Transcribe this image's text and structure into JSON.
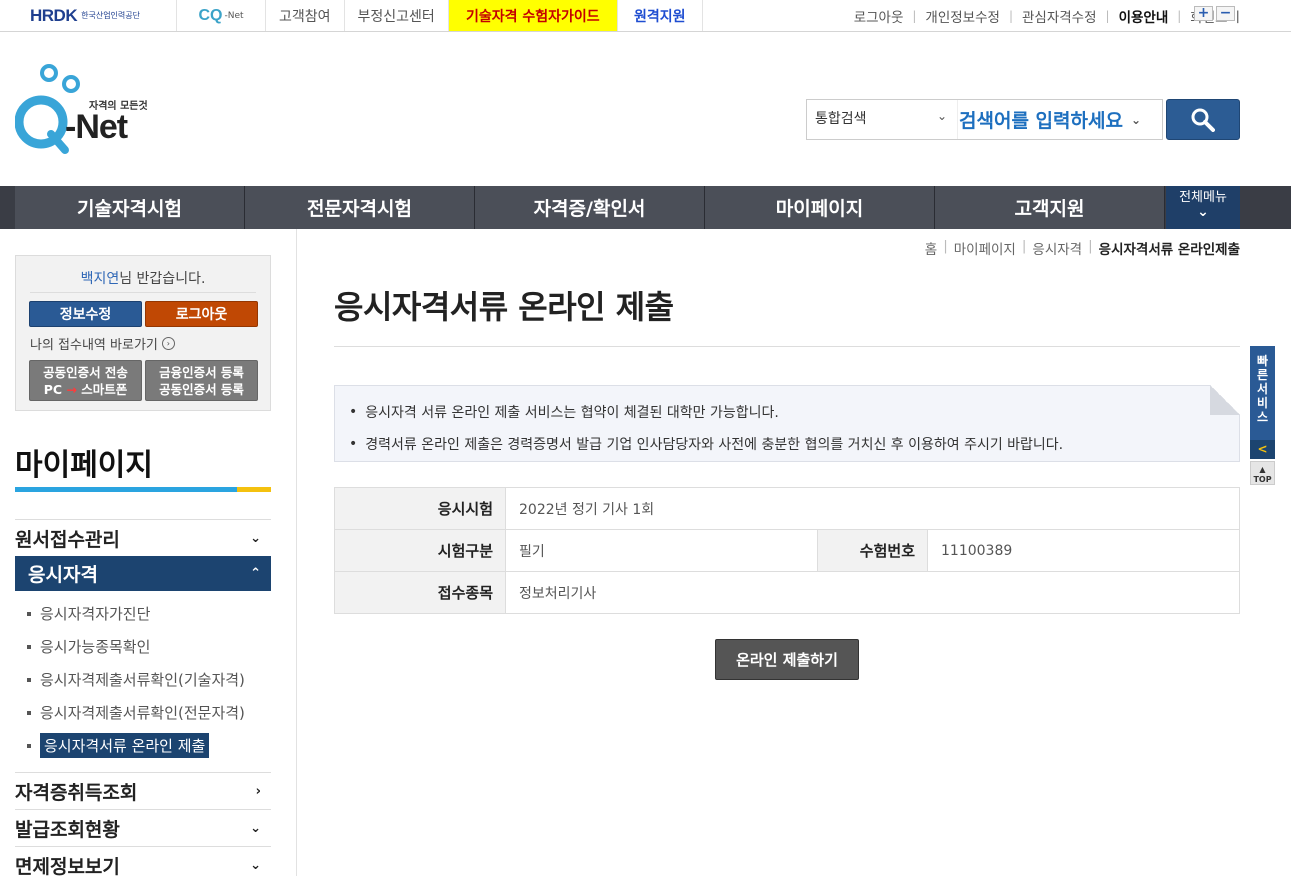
{
  "topbar": {
    "hrdk_logo": "HRDK",
    "hrdk_sub": "한국산업인력공단",
    "cq_logo": "CQ",
    "cq_net": "-Net",
    "links": [
      "고객참여",
      "부정신고센터",
      "기술자격 수험자가이드",
      "원격지원"
    ],
    "utils": [
      "로그아웃",
      "개인정보수정",
      "관심자격수정",
      "이용안내",
      "화면크기"
    ],
    "zoom_in": "+",
    "zoom_out": "−"
  },
  "header": {
    "logo_word": "-Net",
    "logo_tag": "자격의 모든것",
    "search_select": "통합검색",
    "search_placeholder": "검색어를 입력하세요"
  },
  "gnb": {
    "items": [
      "기술자격시험",
      "전문자격시험",
      "자격증/확인서",
      "마이페이지",
      "고객지원"
    ],
    "all_menu": "전체메뉴"
  },
  "user_box": {
    "name": "백지연",
    "greeting_suffix": "님 반갑습니다.",
    "edit_button": "정보수정",
    "logout_button": "로그아웃",
    "quick_link": "나의 접수내역 바로가기",
    "cert_a_line1": "공동인증서 전송",
    "cert_a_line2_pc": "PC",
    "cert_a_line2_arrow": "→",
    "cert_a_line2_phone": "스마트폰",
    "cert_b_line1": "금융인증서 등록",
    "cert_b_line2": "공동인증서 등록"
  },
  "sidebar": {
    "title": "마이페이지",
    "menu": [
      {
        "label": "원서접수관리",
        "icon": "chevron-down"
      },
      {
        "label": "응시자격",
        "icon": "chevron-up"
      },
      {
        "label": "자격증취득조회",
        "icon": "chevron-right"
      },
      {
        "label": "발급조회현황",
        "icon": "chevron-down"
      },
      {
        "label": "면제정보보기",
        "icon": "chevron-down"
      }
    ],
    "sub_items": [
      "응시자격자가진단",
      "응시가능종목확인",
      "응시자격제출서류확인(기술자격)",
      "응시자격제출서류확인(전문자격)",
      "응시자격서류 온라인 제출"
    ]
  },
  "breadcrumb": [
    "홈",
    "마이페이지",
    "응시자격",
    "응시자격서류 온라인제출"
  ],
  "main": {
    "title": "응시자격서류 온라인 제출",
    "notices": [
      "응시자격 서류 온라인 제출 서비스는 협약이 체결된 대학만 가능합니다.",
      "경력서류 온라인 제출은 경력증명서 발급 기업 인사담당자와 사전에 충분한 협의를 거치신 후 이용하여 주시기 바랍니다."
    ],
    "table": {
      "exam_label": "응시시험",
      "exam_value": "2022년 정기 기사 1회",
      "type_label": "시험구분",
      "type_value": "필기",
      "number_label": "수험번호",
      "number_value": "11100389",
      "subject_label": "접수종목",
      "subject_value": "정보처리기사"
    },
    "submit_button": "온라인 제출하기"
  },
  "quick": {
    "service": "빠른서비스",
    "close": "<",
    "top": "TOP"
  },
  "colors": {
    "brand_navy": "#1c4470",
    "gnb_bg": "#3a3d45",
    "logout_orange": "#c04804",
    "highlight_yellow": "#ffff00",
    "accent_blue": "#2aa4e0",
    "accent_yellow": "#f4c10f"
  }
}
